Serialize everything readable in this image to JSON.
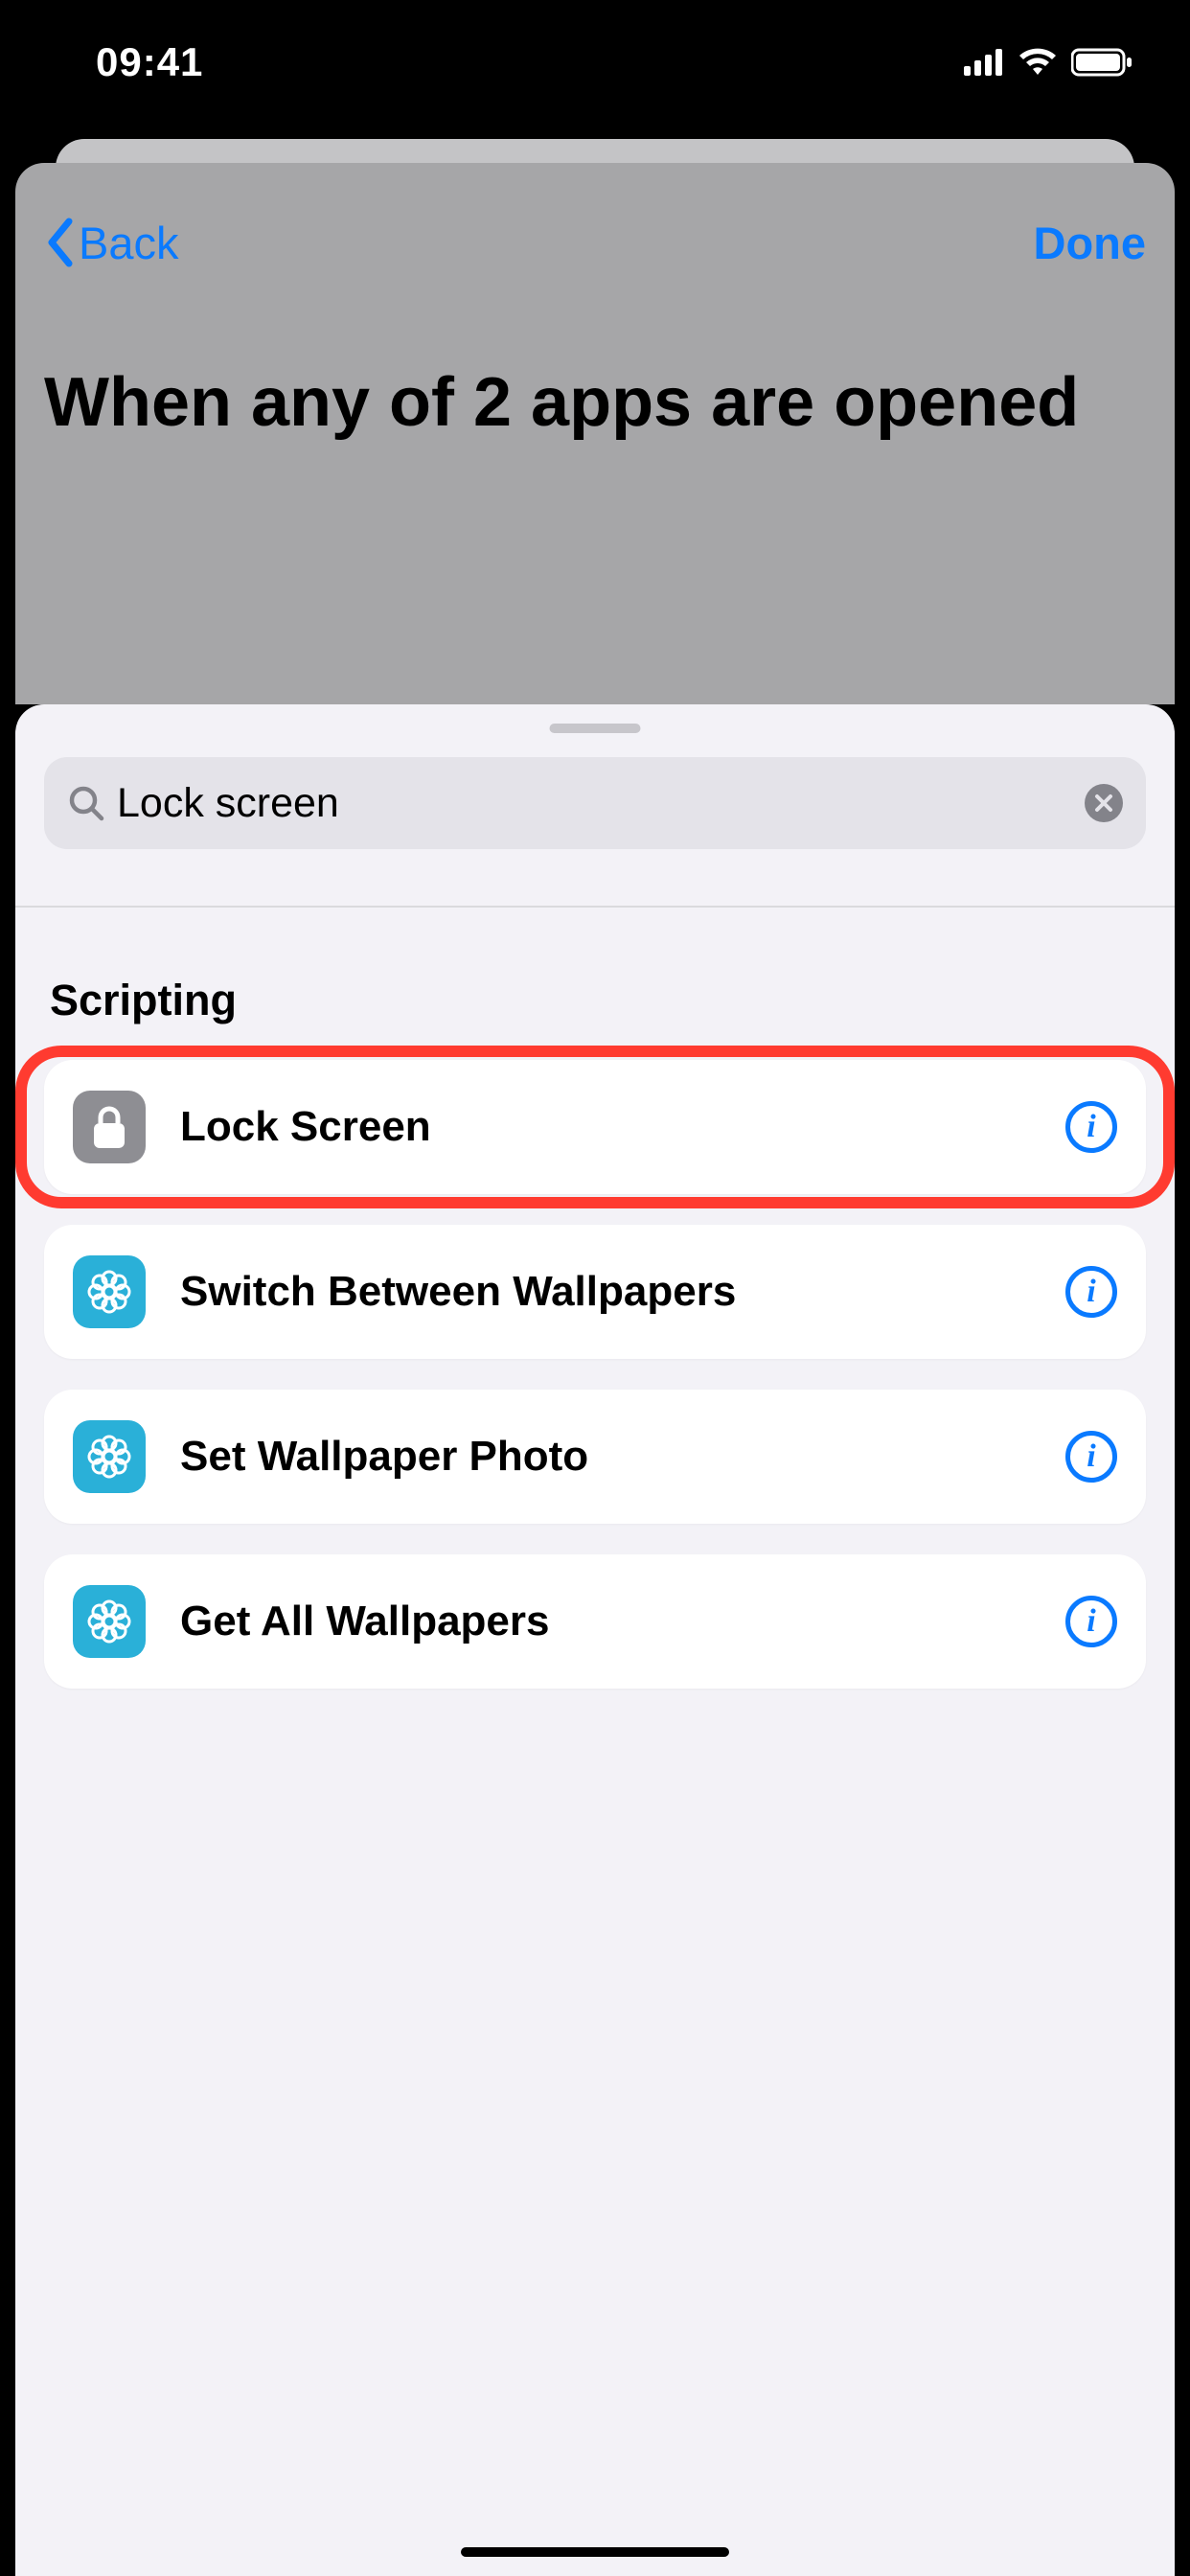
{
  "status": {
    "time": "09:41"
  },
  "nav": {
    "back": "Back",
    "done": "Done"
  },
  "title": "When any of 2 apps are opened",
  "search": {
    "value": "Lock screen"
  },
  "section": {
    "title": "Scripting"
  },
  "actions": [
    {
      "label": "Lock Screen",
      "icon": "lock",
      "highlighted": true
    },
    {
      "label": "Switch Between Wallpapers",
      "icon": "flower",
      "highlighted": false
    },
    {
      "label": "Set Wallpaper Photo",
      "icon": "flower",
      "highlighted": false
    },
    {
      "label": "Get All Wallpapers",
      "icon": "flower",
      "highlighted": false
    }
  ]
}
